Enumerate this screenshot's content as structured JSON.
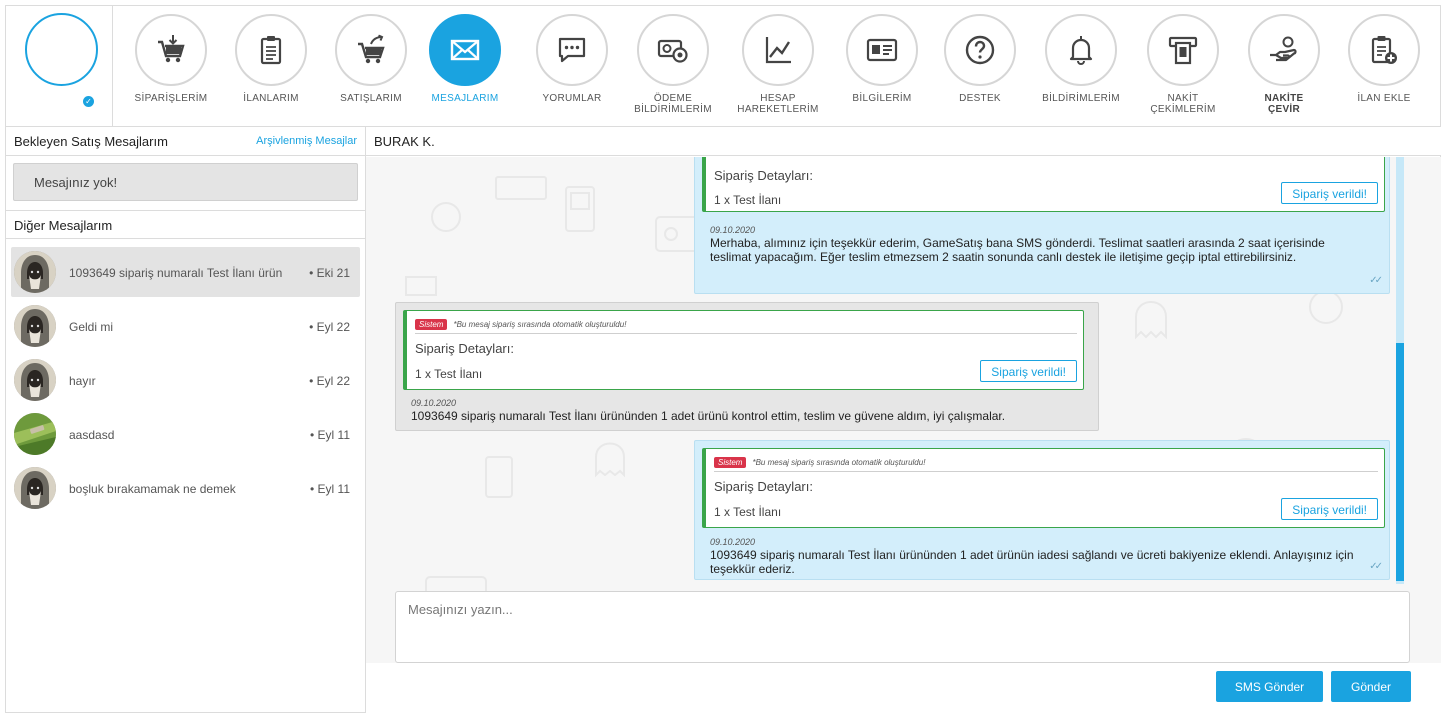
{
  "colors": {
    "accent": "#1aa3e0",
    "system_badge": "#d9344a",
    "order_border": "#3aa54a"
  },
  "nav": [
    {
      "label": "SİPARİŞLERİM",
      "icon": "cart-download-icon"
    },
    {
      "label": "İLANLARIM",
      "icon": "clipboard-icon"
    },
    {
      "label": "SATIŞLARIM",
      "icon": "cart-upload-icon"
    },
    {
      "label": "MESAJLARIM",
      "icon": "envelope-icon",
      "active": true
    },
    {
      "label": "YORUMLAR",
      "icon": "chat-bubble-icon"
    },
    {
      "label": "ÖDEME\nBİLDİRİMLERİM",
      "icon": "payment-icon"
    },
    {
      "label": "HESAP\nHAREKETLERİM",
      "icon": "line-chart-icon"
    },
    {
      "label": "BİLGİLERİM",
      "icon": "id-card-icon"
    },
    {
      "label": "DESTEK",
      "icon": "question-icon"
    },
    {
      "label": "BİLDİRİMLERİM",
      "icon": "bell-icon"
    },
    {
      "label": "NAKİT\nÇEKİMLERİM",
      "icon": "atm-icon"
    },
    {
      "label": "NAKİTE\nÇEVİR",
      "icon": "hand-coin-icon",
      "bold": true
    },
    {
      "label": "İLAN EKLE",
      "icon": "clipboard-add-icon"
    }
  ],
  "left": {
    "pending_title": "Bekleyen Satış Mesajlarım",
    "archived_link": "Arşivlenmiş Mesajlar",
    "empty_text": "Mesajınız yok!",
    "other_title": "Diğer Mesajlarım",
    "conversations": [
      {
        "text": "1093649 sipariş numaralı Test İlanı ürün",
        "date": "• Eki 21",
        "avatar": "hooded-avatar"
      },
      {
        "text": "Geldi mi",
        "date": "• Eyl 22",
        "avatar": "hooded-avatar"
      },
      {
        "text": "hayır",
        "date": "• Eyl 22",
        "avatar": "hooded-avatar"
      },
      {
        "text": "aasdasd",
        "date": "• Eyl 11",
        "avatar": "nature-avatar"
      },
      {
        "text": "boşluk bırakamamak ne demek",
        "date": "• Eyl 11",
        "avatar": "hooded-avatar"
      }
    ]
  },
  "chat": {
    "contact_name": "BURAK K.",
    "messages": [
      {
        "direction": "out",
        "order_title": "Sipariş Detayları:",
        "order_item": "1 x Test İlanı",
        "order_button": "Sipariş verildi!",
        "date": "09.10.2020",
        "text": "Merhaba, alımınız için teşekkür ederim, GameSatış bana SMS gönderdi. Teslimat saatleri arasında 2 saat içerisinde teslimat yapacağım. Eğer teslim etmezsem 2 saatin sonunda canlı destek ile iletişime geçip iptal ettirebilirsiniz."
      },
      {
        "direction": "in",
        "system_badge": "Sistem",
        "system_note": "*Bu mesaj sipariş sırasında otomatik oluşturuldu!",
        "order_title": "Sipariş Detayları:",
        "order_item": "1 x Test İlanı",
        "order_button": "Sipariş verildi!",
        "date": "09.10.2020",
        "text": "1093649 sipariş numaralı Test İlanı ürününden 1 adet ürünü kontrol ettim, teslim ve güvene aldım, iyi çalışmalar."
      },
      {
        "direction": "out",
        "system_badge": "Sistem",
        "system_note": "*Bu mesaj sipariş sırasında otomatik oluşturuldu!",
        "order_title": "Sipariş Detayları:",
        "order_item": "1 x Test İlanı",
        "order_button": "Sipariş verildi!",
        "date": "09.10.2020",
        "text": "1093649 sipariş numaralı Test İlanı ürününden 1 adet ürünün iadesi sağlandı ve ücreti bakiyenize eklendi. Anlayışınız için teşekkür ederiz."
      }
    ],
    "input_placeholder": "Mesajınızı yazın...",
    "sms_button": "SMS Gönder",
    "send_button": "Gönder"
  }
}
